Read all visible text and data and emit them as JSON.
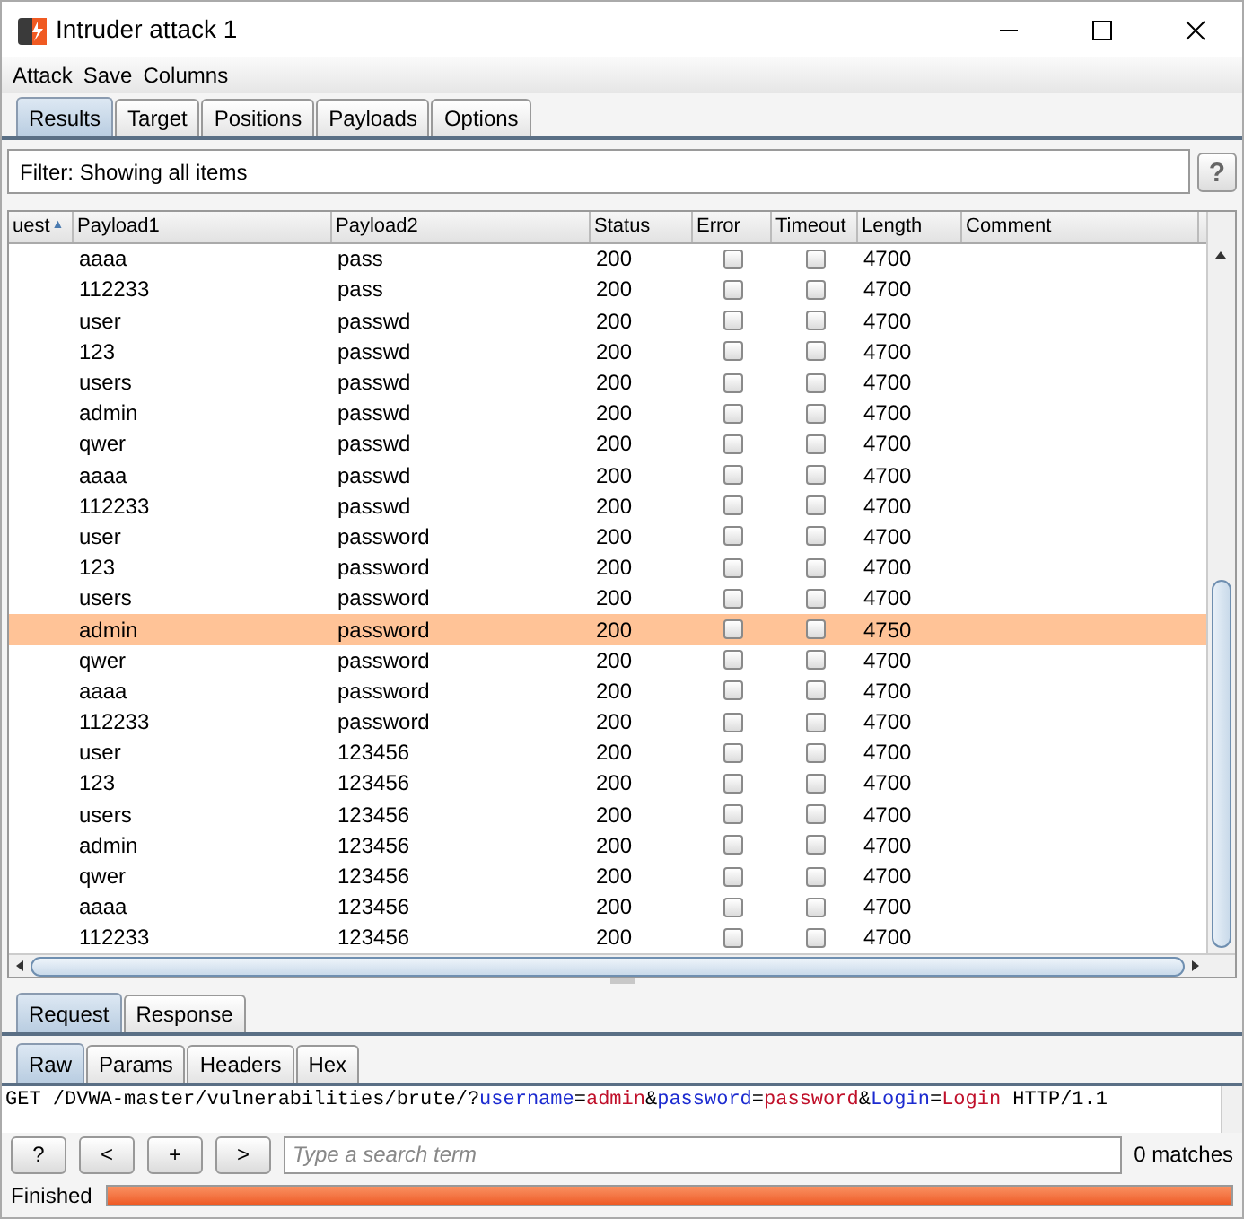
{
  "window": {
    "title": "Intruder attack 1"
  },
  "menu": [
    "Attack",
    "Save",
    "Columns"
  ],
  "tabs": [
    {
      "label": "Results",
      "selected": true
    },
    {
      "label": "Target",
      "selected": false
    },
    {
      "label": "Positions",
      "selected": false
    },
    {
      "label": "Payloads",
      "selected": false
    },
    {
      "label": "Options",
      "selected": false
    }
  ],
  "filter": {
    "text": "Filter: Showing all items",
    "help": "?"
  },
  "table": {
    "columns": [
      {
        "label": "uest",
        "sort_icon": "▲"
      },
      {
        "label": "Payload1"
      },
      {
        "label": "Payload2"
      },
      {
        "label": "Status"
      },
      {
        "label": "Error"
      },
      {
        "label": "Timeout"
      },
      {
        "label": "Length"
      },
      {
        "label": "Comment"
      }
    ],
    "rows": [
      {
        "payload1": "aaaa",
        "payload2": "pass",
        "status": "200",
        "error": false,
        "timeout": false,
        "length": "4700",
        "selected": false
      },
      {
        "payload1": "112233",
        "payload2": "pass",
        "status": "200",
        "error": false,
        "timeout": false,
        "length": "4700",
        "selected": false
      },
      {
        "payload1": "user",
        "payload2": "passwd",
        "status": "200",
        "error": false,
        "timeout": false,
        "length": "4700",
        "selected": false
      },
      {
        "payload1": "123",
        "payload2": "passwd",
        "status": "200",
        "error": false,
        "timeout": false,
        "length": "4700",
        "selected": false
      },
      {
        "payload1": "users",
        "payload2": "passwd",
        "status": "200",
        "error": false,
        "timeout": false,
        "length": "4700",
        "selected": false
      },
      {
        "payload1": "admin",
        "payload2": "passwd",
        "status": "200",
        "error": false,
        "timeout": false,
        "length": "4700",
        "selected": false
      },
      {
        "payload1": "qwer",
        "payload2": "passwd",
        "status": "200",
        "error": false,
        "timeout": false,
        "length": "4700",
        "selected": false
      },
      {
        "payload1": "aaaa",
        "payload2": "passwd",
        "status": "200",
        "error": false,
        "timeout": false,
        "length": "4700",
        "selected": false
      },
      {
        "payload1": "112233",
        "payload2": "passwd",
        "status": "200",
        "error": false,
        "timeout": false,
        "length": "4700",
        "selected": false
      },
      {
        "payload1": "user",
        "payload2": "password",
        "status": "200",
        "error": false,
        "timeout": false,
        "length": "4700",
        "selected": false
      },
      {
        "payload1": "123",
        "payload2": "password",
        "status": "200",
        "error": false,
        "timeout": false,
        "length": "4700",
        "selected": false
      },
      {
        "payload1": "users",
        "payload2": "password",
        "status": "200",
        "error": false,
        "timeout": false,
        "length": "4700",
        "selected": false
      },
      {
        "payload1": "admin",
        "payload2": "password",
        "status": "200",
        "error": false,
        "timeout": false,
        "length": "4750",
        "selected": true
      },
      {
        "payload1": "qwer",
        "payload2": "password",
        "status": "200",
        "error": false,
        "timeout": false,
        "length": "4700",
        "selected": false
      },
      {
        "payload1": "aaaa",
        "payload2": "password",
        "status": "200",
        "error": false,
        "timeout": false,
        "length": "4700",
        "selected": false
      },
      {
        "payload1": "112233",
        "payload2": "password",
        "status": "200",
        "error": false,
        "timeout": false,
        "length": "4700",
        "selected": false
      },
      {
        "payload1": "user",
        "payload2": "123456",
        "status": "200",
        "error": false,
        "timeout": false,
        "length": "4700",
        "selected": false
      },
      {
        "payload1": "123",
        "payload2": "123456",
        "status": "200",
        "error": false,
        "timeout": false,
        "length": "4700",
        "selected": false
      },
      {
        "payload1": "users",
        "payload2": "123456",
        "status": "200",
        "error": false,
        "timeout": false,
        "length": "4700",
        "selected": false
      },
      {
        "payload1": "admin",
        "payload2": "123456",
        "status": "200",
        "error": false,
        "timeout": false,
        "length": "4700",
        "selected": false
      },
      {
        "payload1": "qwer",
        "payload2": "123456",
        "status": "200",
        "error": false,
        "timeout": false,
        "length": "4700",
        "selected": false
      },
      {
        "payload1": "aaaa",
        "payload2": "123456",
        "status": "200",
        "error": false,
        "timeout": false,
        "length": "4700",
        "selected": false
      },
      {
        "payload1": "112233",
        "payload2": "123456",
        "status": "200",
        "error": false,
        "timeout": false,
        "length": "4700",
        "selected": false
      }
    ]
  },
  "message_tabs": [
    {
      "label": "Request",
      "selected": true
    },
    {
      "label": "Response",
      "selected": false
    }
  ],
  "view_tabs": [
    {
      "label": "Raw",
      "selected": true
    },
    {
      "label": "Params",
      "selected": false
    },
    {
      "label": "Headers",
      "selected": false
    },
    {
      "label": "Hex",
      "selected": false
    }
  ],
  "request_line": [
    {
      "kind": "plain",
      "text": "GET /DVWA-master/vulnerabilities/brute/?"
    },
    {
      "kind": "name",
      "text": "username"
    },
    {
      "kind": "plain",
      "text": "="
    },
    {
      "kind": "value",
      "text": "admin"
    },
    {
      "kind": "plain",
      "text": "&"
    },
    {
      "kind": "name",
      "text": "password"
    },
    {
      "kind": "plain",
      "text": "="
    },
    {
      "kind": "value",
      "text": "password"
    },
    {
      "kind": "plain",
      "text": "&"
    },
    {
      "kind": "name",
      "text": "Login"
    },
    {
      "kind": "plain",
      "text": "="
    },
    {
      "kind": "value",
      "text": "Login"
    },
    {
      "kind": "plain",
      "text": " HTTP/1.1"
    }
  ],
  "search_bar": {
    "buttons": [
      "?",
      "<",
      "+",
      ">"
    ],
    "placeholder": "Type a search term",
    "matches": "0 matches"
  },
  "status_bar": {
    "text": "Finished",
    "level": 1
  }
}
